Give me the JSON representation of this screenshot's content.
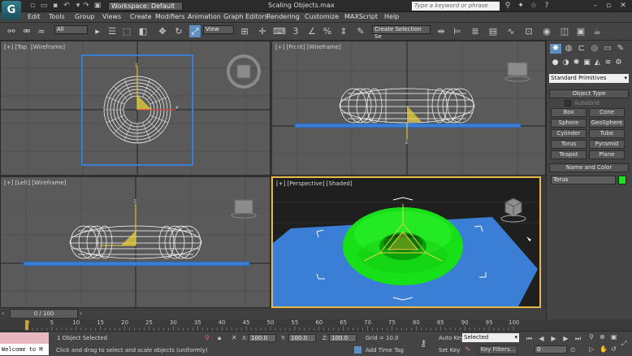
{
  "titlebar": {
    "logo": "G",
    "workspace": "Workspace: Default",
    "document_title": "Scaling Objects.max",
    "help_search_placeholder": "Type a keyword or phrase"
  },
  "menu": [
    "Edit",
    "Tools",
    "Group",
    "Views",
    "Create",
    "Modifiers",
    "Animation",
    "Graph Editors",
    "Rendering",
    "Customize",
    "MAXScript",
    "Help"
  ],
  "toolbar": {
    "selection_filter": "All",
    "reference_coord": "View",
    "named_selection": "Create Selection Se"
  },
  "viewports": {
    "top": "[+] [Top] [Wireframe]",
    "front": "[+] [Front] [Wireframe]",
    "left": "[+] [Left] [Wireframe]",
    "perspective": "[+] [Perspective] [Shaded]"
  },
  "command_panel": {
    "category": "Standard Primitives",
    "object_type_header": "Object Type",
    "autogrid": "AutoGrid",
    "buttons": [
      "Box",
      "Cone",
      "Sphere",
      "GeoSphere",
      "Cylinder",
      "Tube",
      "Torus",
      "Pyramid",
      "Teapot",
      "Plane"
    ],
    "name_color_header": "Name and Color",
    "object_name": "Torus",
    "object_color": "#1fe21f"
  },
  "timeline": {
    "frame_counter": "0 / 100",
    "ticks": [
      "0",
      "5",
      "10",
      "15",
      "20",
      "25",
      "30",
      "35",
      "40",
      "45",
      "50",
      "55",
      "60",
      "65",
      "70",
      "75",
      "80",
      "85",
      "90",
      "95",
      "100"
    ]
  },
  "status": {
    "maxscript_listener": "Welcome to M",
    "selection_info": "1 Object Selected",
    "prompt": "Click and drag to select and scale objects (uniformly)",
    "x_label": "X:",
    "x_value": "100.0",
    "y_label": "Y:",
    "y_value": "100.0",
    "z_label": "Z:",
    "z_value": "100.0",
    "grid": "Grid = 10.0",
    "add_time_tag": "Add Time Tag",
    "auto_key": "Auto Key",
    "selected": "Selected",
    "set_key": "Set Key",
    "key_filters": "Key Filters...",
    "current_frame": "0"
  },
  "colors": {
    "active_border": "#e4b84a",
    "plane_blue": "#3a7fd5",
    "torus_green": "#18e018",
    "selection_yellow": "#e8d23a"
  }
}
